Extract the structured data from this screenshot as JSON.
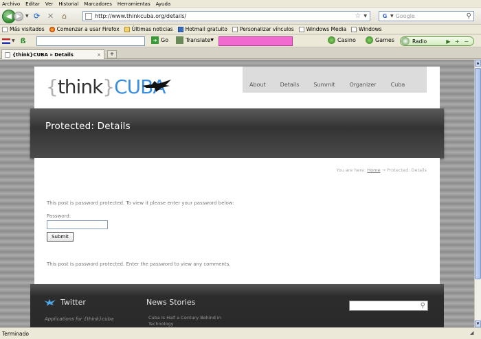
{
  "menu": [
    "Archivo",
    "Editar",
    "Ver",
    "Historial",
    "Marcadores",
    "Herramientas",
    "Ayuda"
  ],
  "nav": {
    "url": "http://www.thinkcuba.org/details/",
    "search_placeholder": "Google"
  },
  "bookmarks": [
    "Más visitados",
    "Comenzar a usar Firefox",
    "Últimas noticias",
    "Hotmail gratuito",
    "Personalizar vínculos",
    "Windows Media",
    "Windows"
  ],
  "toolbar": {
    "go": "Go",
    "translate": "Translate",
    "casino": "Casino",
    "games": "Games",
    "radio": "Radio",
    "radio_controls": "▶ + −"
  },
  "tab": {
    "title": "{think}CUBA » Details",
    "close": "×",
    "new": "+"
  },
  "site": {
    "logo_brace_open": "{",
    "logo_think": "think",
    "logo_brace_close": "}",
    "logo_cuba": "CUBA",
    "nav": [
      "About",
      "Details",
      "Summit",
      "Organizer",
      "Cuba"
    ],
    "page_title": "Protected: Details",
    "breadcrumb_prefix": "You are here:",
    "breadcrumb_home": "Home",
    "breadcrumb_sep": "→",
    "breadcrumb_current": "Protected: Details",
    "protected_msg": "This post is password protected. To view it please enter your password below:",
    "password_label": "Password:",
    "submit_label": "Submit",
    "comments_msg": "This post is password protected. Enter the password to view any comments.",
    "footer": {
      "twitter_heading": "Twitter",
      "twitter_sub": "Applications for {think}cuba",
      "news_heading": "News Stories",
      "news_item": "Cuba Is Half a Century Behind in Technology"
    }
  },
  "status": "Terminado"
}
